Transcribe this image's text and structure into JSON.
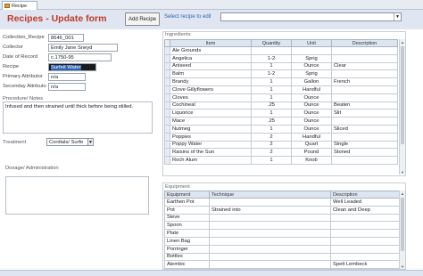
{
  "tab": {
    "label": "Recipe"
  },
  "header": {
    "title": "Recipes - Update form",
    "add_button": "Add Recipe",
    "select_label": "Select recipe to edit",
    "select_value": ""
  },
  "fields": [
    {
      "label": "Collection_Recipe",
      "value": "8646_001"
    },
    {
      "label": "Collector",
      "value": "Emily Jane Sneyd"
    },
    {
      "label": "Date of Record",
      "value": "c.1750-95"
    },
    {
      "label": "Recipe",
      "value": "Surfeit Water"
    },
    {
      "label": "Primary Attributor",
      "value": "n/a"
    },
    {
      "label": "Seconday Attributo",
      "value": "n/a"
    }
  ],
  "procedure": {
    "label": "Procedure/ Notes",
    "text": "Infused and then strained until thick before being stilled."
  },
  "treatment": {
    "label": "Treatment",
    "value": "Cordials/ Surfe"
  },
  "dosage": {
    "label": "Dosage/ Administration",
    "text": ""
  },
  "ingredients": {
    "title": "Ingredients",
    "columns": [
      "Item",
      "Quantity",
      "Unit",
      "Description"
    ],
    "rows": [
      [
        "Ale Grounds",
        "",
        "",
        ""
      ],
      [
        "Angelica",
        "1-2",
        "Sprig",
        ""
      ],
      [
        "Aniseed",
        "1",
        "Ounce",
        "Clear"
      ],
      [
        "Balm",
        "1-2",
        "Sprig",
        ""
      ],
      [
        "Brandy",
        "1",
        "Gallon",
        "French"
      ],
      [
        "Clove Gillyflowers",
        "1",
        "Handful",
        ""
      ],
      [
        "Cloves",
        "1",
        "Ounce",
        ""
      ],
      [
        "Cochineal",
        ".25",
        "Ounce",
        "Beaten"
      ],
      [
        "Liquorice",
        "1",
        "Ounce",
        "Slit"
      ],
      [
        "Mace",
        ".25",
        "Ounce",
        ""
      ],
      [
        "Nutmeg",
        "1",
        "Ounce",
        "Sliced"
      ],
      [
        "Poppies",
        "2",
        "Handful",
        ""
      ],
      [
        "Poppy Water",
        "2",
        "Quart",
        "Single"
      ],
      [
        "Raisins of the Sun",
        "2",
        "Pound",
        "Stoned"
      ],
      [
        "Roch Alum",
        "1",
        "Knob",
        ""
      ]
    ]
  },
  "equipment": {
    "title": "Equipment",
    "columns": [
      "Equipment",
      "Technique",
      "Description"
    ],
    "rows": [
      [
        "Earthen Pot",
        "",
        "Well Leaded"
      ],
      [
        "Pot",
        "Strained into",
        "Clean and Deep"
      ],
      [
        "Sieve",
        "",
        ""
      ],
      [
        "Spoon",
        "",
        ""
      ],
      [
        "Plate",
        "",
        ""
      ],
      [
        "Linen Bag",
        "",
        ""
      ],
      [
        "Porringer",
        "",
        ""
      ],
      [
        "Bottles",
        "",
        ""
      ],
      [
        "Alembic",
        "",
        "Spelt Lembeck"
      ]
    ]
  },
  "colors": {
    "title": "#c0392b",
    "header_bg": "#dfe6f1",
    "accent": "#2a66b5"
  }
}
